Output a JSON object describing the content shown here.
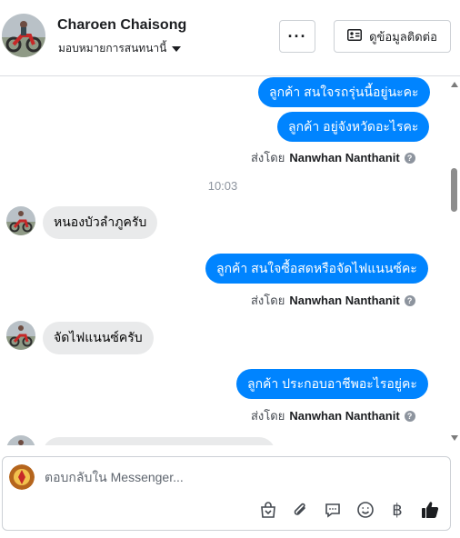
{
  "header": {
    "contact_name": "Charoen Chaisong",
    "assign_label": "มอบหมายการสนทนานี้",
    "more_label": "···",
    "contact_info_label": "ดูข้อมูลติดต่อ"
  },
  "messages": {
    "out_1": "ลูกค้า  สนใจรถรุ่นนี้อยู่นะคะ",
    "out_2": "ลูกค้า อยู่จังหวัดอะไรคะ",
    "sent_by_prefix": "ส่งโดย",
    "sender_name": "Nanwhan Nanthanit",
    "timestamp": "10:03",
    "in_1": "หนองบัวลำภูครับ",
    "out_3": "ลูกค้า  สนใจซื้อสดหรือจัดไฟแนนซ์คะ",
    "in_2": "จัดไฟแนนซ์ครับ",
    "out_4": "ลูกค้า  ประกอบอาชีพอะไรอยู่คะ"
  },
  "composer": {
    "placeholder": "ตอบกลับใน Messenger..."
  },
  "icons": {
    "more": "more-dots-icon",
    "contact_card": "id-card-icon",
    "info": "info-icon",
    "shop": "shopping-bag-icon",
    "attach": "paperclip-icon",
    "saved_reply": "chat-bubble-icon",
    "emoji": "smiley-icon",
    "payment": "baht-icon",
    "like": "thumbs-up-icon"
  },
  "colors": {
    "outgoing_bubble": "#0084ff",
    "incoming_bubble": "#e9eaeb",
    "like_icon": "#1c1e21"
  }
}
